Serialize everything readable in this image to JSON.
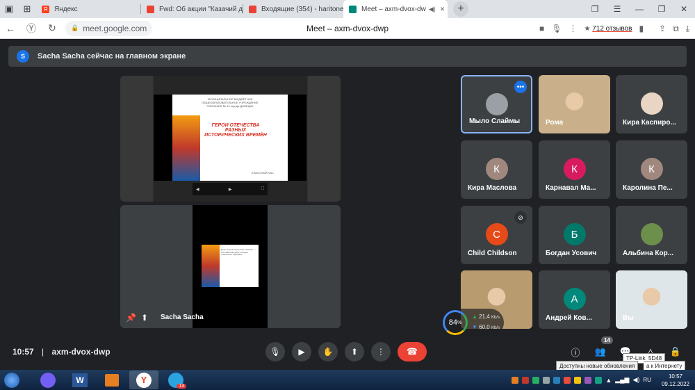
{
  "browser": {
    "tabs": [
      {
        "label": "Яндекс",
        "favicon_color": "#fc3f1d",
        "favicon_letter": "Я"
      },
      {
        "label": "Fwd: Об акции \"Казачий д",
        "favicon_color": "#ea4335"
      },
      {
        "label": "Входящие (354) - haritone",
        "favicon_color": "#ea4335"
      },
      {
        "label": "Meet – axm-dvox-dw",
        "favicon_color": "#00897b",
        "active": true
      }
    ],
    "url": "meet.google.com",
    "page_title": "Meet – axm-dvox-dwp",
    "reviews": "712 отзывов",
    "reviews_star": "★"
  },
  "banner": {
    "avatar_letter": "S",
    "text": "Sacha Sacha сейчас на главном экране"
  },
  "presentation": {
    "slide_header": "МУНИЦИПАЛЬНОЕ БЮДЖЕТНОЕ ОБЩЕОБРАЗОВАТЕЛЬНОЕ УЧРЕЖДЕНИЕ ГИМНАЗИЯ № 10 города ДОНЕЦКА",
    "slide_title": "ГЕРОИ ОТЕЧЕСТВА РАЗНЫХ ИСТОРИЧЕСКИХ ВРЕМЁН",
    "slide_footer": "КЛАССНЫЙ ЧАС",
    "thumb_text": "День Героев Отечества в России — это памятная дата, которая отмечается 9 декабря",
    "presenter_name": "Sacha Sacha"
  },
  "participants": [
    {
      "name": "Мыло Слаймы",
      "type": "avatar",
      "avatar_color": "#9aa0a6",
      "active_speaker": true
    },
    {
      "name": "Рома",
      "type": "video",
      "bg": "#c9b08a"
    },
    {
      "name": "Кира Каспиро...",
      "type": "avatar",
      "avatar_color": "#e8d5c4"
    },
    {
      "name": "Кира Маслова",
      "type": "letter",
      "letter": "К",
      "avatar_color": "#a1887f"
    },
    {
      "name": "Карнавал Ма...",
      "type": "letter",
      "letter": "К",
      "avatar_color": "#d81b60"
    },
    {
      "name": "Каролина Пе...",
      "type": "letter",
      "letter": "К",
      "avatar_color": "#a1887f"
    },
    {
      "name": "Child Childson",
      "type": "letter",
      "letter": "C",
      "avatar_color": "#e64a19"
    },
    {
      "name": "Богдан Усович",
      "type": "letter",
      "letter": "Б",
      "avatar_color": "#00796b"
    },
    {
      "name": "Альбина Кор...",
      "type": "avatar",
      "avatar_color": "#6d8f4c"
    },
    {
      "name": "",
      "type": "video",
      "bg": "#b89b6e"
    },
    {
      "name": "Андрей Ков...",
      "type": "letter",
      "letter": "А",
      "avatar_color": "#00897b"
    },
    {
      "name": "Вы",
      "type": "video",
      "bg": "#dfe6ea"
    }
  ],
  "bottom": {
    "time": "10:57",
    "separator": "|",
    "meeting_code": "axm-dvox-dwp",
    "people_count": "14"
  },
  "network": {
    "percent": "84",
    "percent_sign": "%",
    "up": "21,4",
    "down": "60,0",
    "unit": "Kb/s"
  },
  "tooltips": {
    "wifi": "TP-Link_5D48",
    "update": "Доступны новые обновления",
    "internet": "а к Интернету"
  },
  "taskbar": {
    "clock_time": "10:57",
    "clock_date": "09.12.2022",
    "telegram_badge": "13",
    "lang": "RU"
  }
}
